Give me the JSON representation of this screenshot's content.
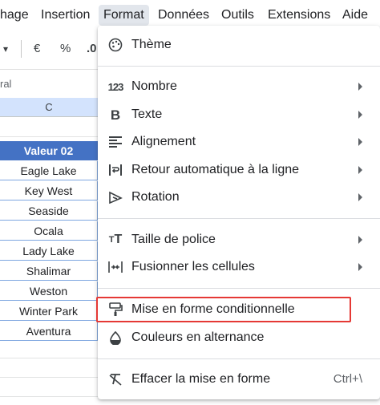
{
  "menubar": {
    "items": [
      "hage",
      "Insertion",
      "Format",
      "Données",
      "Outils",
      "Extensions",
      "Aide"
    ],
    "active": "Format"
  },
  "toolbar": {
    "dropdown_caret": "▾",
    "currency": "€",
    "percent": "%",
    "decimal": ".0"
  },
  "formula_bar": {
    "cell_ref_partial": "ral"
  },
  "sheet": {
    "column_header": "C",
    "cells": [
      "Valeur 02",
      "Eagle Lake",
      "Key West",
      "Seaside",
      "Ocala",
      "Lady Lake",
      "Shalimar",
      "Weston",
      "Winter Park",
      "Aventura"
    ]
  },
  "format_menu": {
    "items": [
      {
        "label": "Thème",
        "icon": "palette-icon",
        "submenu": false
      },
      {
        "label": "Nombre",
        "icon": "number-123-icon",
        "submenu": true
      },
      {
        "label": "Texte",
        "icon": "bold-b-icon",
        "submenu": true
      },
      {
        "label": "Alignement",
        "icon": "align-left-icon",
        "submenu": true
      },
      {
        "label": "Retour automatique à la ligne",
        "icon": "text-wrap-icon",
        "submenu": true
      },
      {
        "label": "Rotation",
        "icon": "text-rotation-icon",
        "submenu": true
      },
      {
        "label": "Taille de police",
        "icon": "font-size-icon",
        "submenu": true
      },
      {
        "label": "Fusionner les cellules",
        "icon": "merge-cells-icon",
        "submenu": true
      },
      {
        "label": "Mise en forme conditionnelle",
        "icon": "paint-roller-icon",
        "submenu": false,
        "highlighted": true
      },
      {
        "label": "Couleurs en alternance",
        "icon": "contrast-drop-icon",
        "submenu": false
      },
      {
        "label": "Effacer la mise en forme",
        "icon": "clear-format-icon",
        "submenu": false,
        "shortcut": "Ctrl+\\"
      }
    ]
  },
  "colors": {
    "header_fill": "#4472c4",
    "column_selected": "#d3e3fd",
    "highlight_border": "#e53935"
  }
}
